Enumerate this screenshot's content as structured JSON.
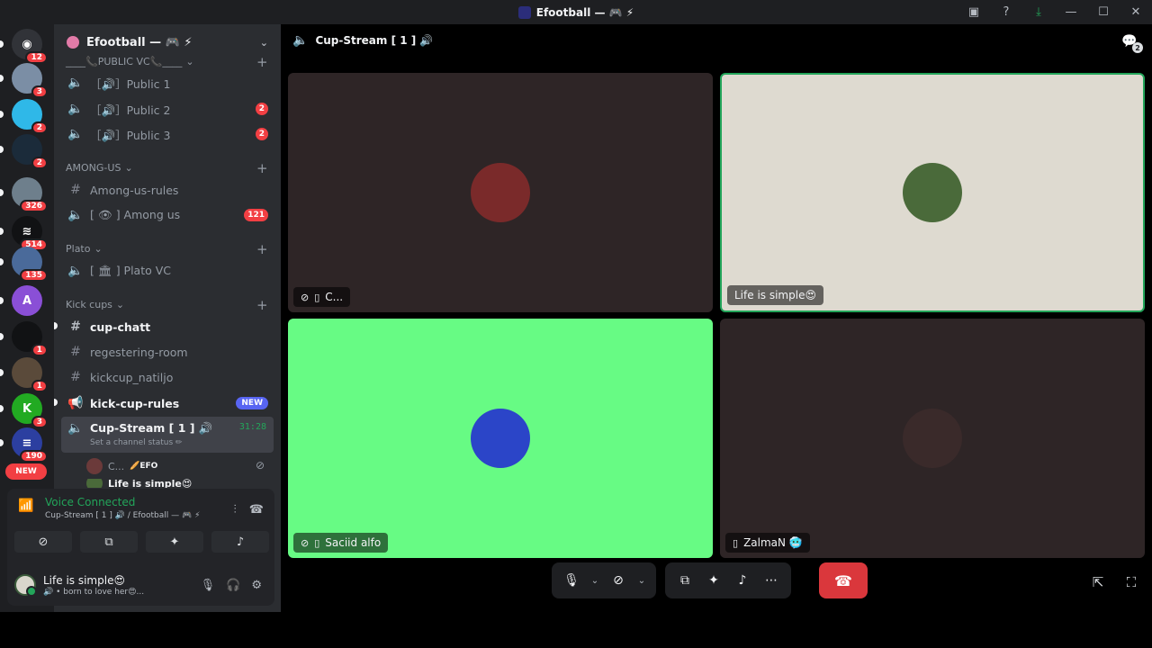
{
  "window": {
    "title": "Efootball — 🎮 ⚡"
  },
  "rail": {
    "servers": [
      {
        "badge": "12",
        "color": "#313338",
        "glyph": "◉"
      },
      {
        "badge": "3",
        "color": "#7b8ea5",
        "glyph": ""
      },
      {
        "badge": "2",
        "color": "#2fb8e8",
        "glyph": ""
      },
      {
        "badge": "2",
        "color": "#1b2b3a",
        "glyph": ""
      },
      {
        "badge": "326",
        "color": "#6e7f8c",
        "glyph": ""
      },
      {
        "badge": "514",
        "color": "#111214",
        "glyph": "≋"
      },
      {
        "badge": "135",
        "color": "#4a6a9a",
        "glyph": ""
      },
      {
        "badge": "",
        "color": "#8a4fd6",
        "glyph": "A"
      },
      {
        "badge": "1",
        "color": "#111214",
        "glyph": ""
      },
      {
        "badge": "1",
        "color": "#5a4a3a",
        "glyph": ""
      },
      {
        "badge": "3",
        "color": "#2a2",
        "glyph": "K"
      },
      {
        "badge": "190",
        "color": "#2c3fa0",
        "glyph": "≡"
      }
    ],
    "new_label": "NEW"
  },
  "sidebar": {
    "guild_name": "Efootball — 🎮 ⚡",
    "cat_public": "____📞PUBLIC VC📞____",
    "public1": "［🔊］Public 1",
    "public2": "［🔊］Public 2",
    "public3": "［🔊］Public 3",
    "public2_badge": "2",
    "public3_badge": "2",
    "cat_among": "AMONG-US",
    "among_rules": "Among-us-rules",
    "among_vc": "[ 👁 ] Among us",
    "among_badge": "121",
    "cat_plato": "Plato",
    "plato_vc": "[ 🏛 ] Plato VC",
    "cat_kick": "Kick cups",
    "cup_chatt": "cup-chatt",
    "registering": "regestering-room",
    "natiljo": "kickcup_natiljo",
    "kick_rules": "kick-cup-rules",
    "new_badge": "NEW",
    "cup_stream": "Cup-Stream [ 1 ] 🔊",
    "cup_time": "31:28",
    "cup_status": "Set a channel status ✏",
    "member1": "C...",
    "member1_tag": "🥖EFO",
    "member2": "Life is simple😍"
  },
  "voice": {
    "title": "Voice Connected",
    "sub": "Cup-Stream [ 1 ] 🔊 / Efootball — 🎮 ⚡",
    "user_name": "Life is simple😍",
    "user_status": "🔊 • born to love her😍..."
  },
  "main": {
    "channel_title": "Cup-Stream [ 1 ] 🔊",
    "chat_badge": "2",
    "tiles": [
      {
        "label": "C...",
        "bg": "#2e2526",
        "avatar": "#7a2a2a",
        "muted": true
      },
      {
        "label": "Life is simple😍",
        "bg": "#dedad0",
        "avatar": "#4a6a3a",
        "muted": false
      },
      {
        "label": "Saciid alfo",
        "bg": "#67fb84",
        "avatar": "#2b45c8",
        "muted": true
      },
      {
        "label": "ZalmaN 🥶",
        "bg": "#2e2526",
        "avatar": "#3a2a2a",
        "muted": false
      }
    ]
  }
}
